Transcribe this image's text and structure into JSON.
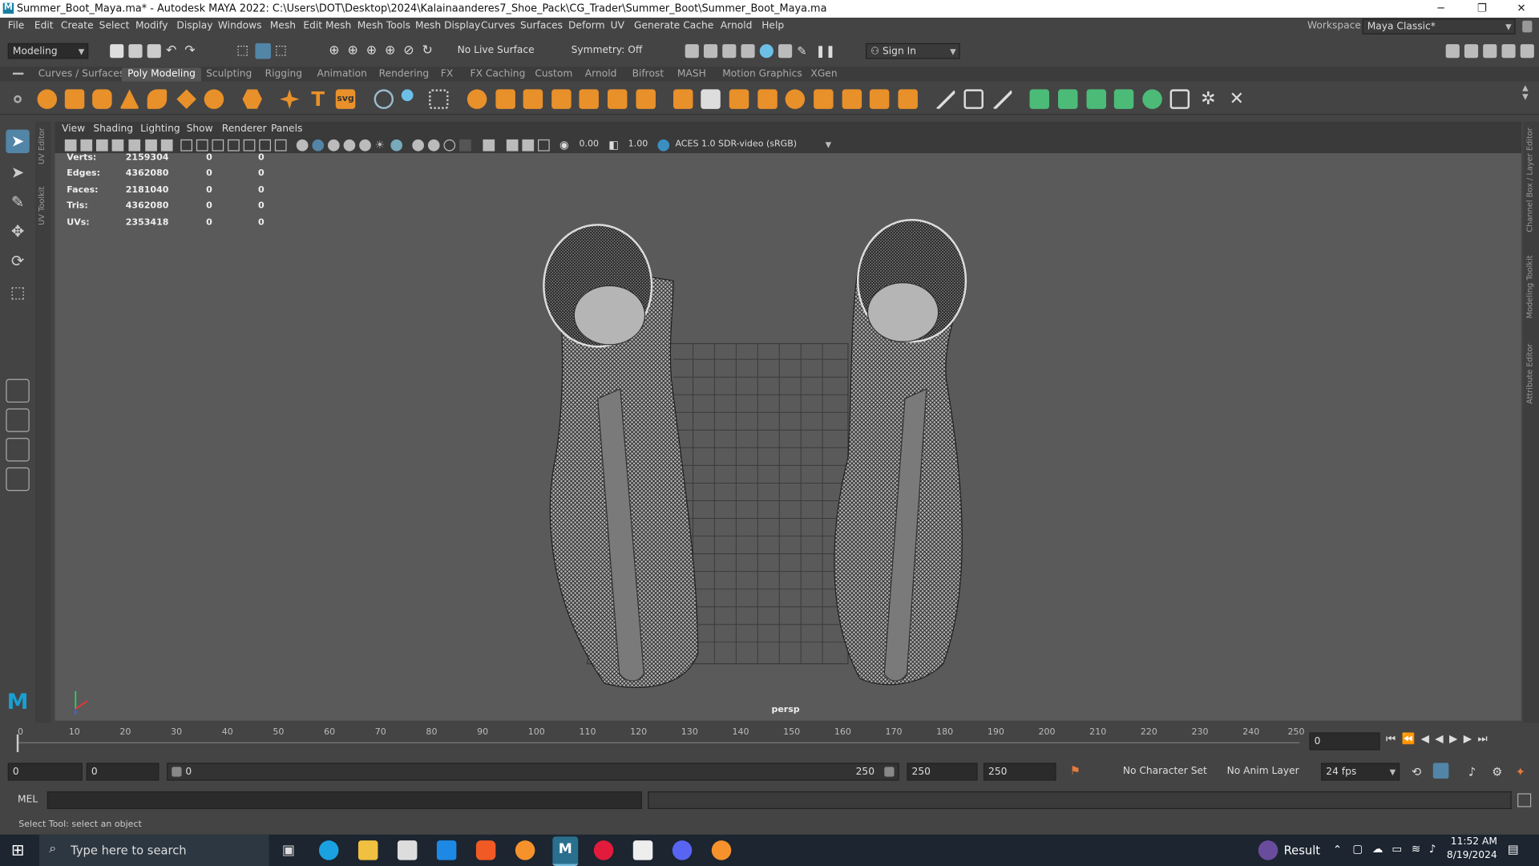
{
  "window": {
    "title": "Summer_Boot_Maya.ma* - Autodesk MAYA 2022: C:\\Users\\DOT\\Desktop\\2024\\Kalainaanderes7_Shoe_Pack\\CG_Trader\\Summer_Boot\\Summer_Boot_Maya.ma",
    "minimize": "─",
    "restore": "❐",
    "close": "✕",
    "logo": "M"
  },
  "menubar": {
    "items": [
      "File",
      "Edit",
      "Create",
      "Select",
      "Modify",
      "Display",
      "Windows",
      "Mesh",
      "Edit Mesh",
      "Mesh Tools",
      "Mesh Display",
      "Curves",
      "Surfaces",
      "Deform",
      "UV",
      "Generate",
      "Cache",
      "Arnold",
      "Help"
    ],
    "workspace_label": "Workspace :",
    "workspace_value": "Maya Classic*"
  },
  "statusline": {
    "mode": "Modeling",
    "live_surface": "No Live Surface",
    "symmetry": "Symmetry: Off",
    "sign_in": "Sign In"
  },
  "shelf": {
    "tabs": [
      "Curves / Surfaces",
      "Poly Modeling",
      "Sculpting",
      "Rigging",
      "Animation",
      "Rendering",
      "FX",
      "FX Caching",
      "Custom",
      "Arnold",
      "Bifrost",
      "MASH",
      "Motion Graphics",
      "XGen"
    ],
    "active_tab": "Poly Modeling",
    "text_icon": "T",
    "svg_icon": "svg"
  },
  "side_tabs": {
    "left": [
      "UV Editor",
      "UV Toolkit"
    ],
    "right": [
      "Channel Box / Layer Editor",
      "Modeling Toolkit",
      "Attribute Editor"
    ]
  },
  "panel": {
    "menu": [
      "View",
      "Shading",
      "Lighting",
      "Show",
      "Renderer",
      "Panels"
    ],
    "exposure": "0.00",
    "gamma": "1.00",
    "color_space": "ACES 1.0 SDR-video (sRGB)"
  },
  "hud": {
    "rows": [
      {
        "label": "Verts:",
        "total": "2159304",
        "sel": "0",
        "comp": "0"
      },
      {
        "label": "Edges:",
        "total": "4362080",
        "sel": "0",
        "comp": "0"
      },
      {
        "label": "Faces:",
        "total": "2181040",
        "sel": "0",
        "comp": "0"
      },
      {
        "label": "Tris:",
        "total": "4362080",
        "sel": "0",
        "comp": "0"
      },
      {
        "label": "UVs:",
        "total": "2353418",
        "sel": "0",
        "comp": "0"
      }
    ],
    "camera": "persp"
  },
  "timeslider": {
    "ticks": [
      "0",
      "10",
      "20",
      "30",
      "40",
      "50",
      "60",
      "70",
      "80",
      "90",
      "100",
      "110",
      "120",
      "130",
      "140",
      "150",
      "160",
      "170",
      "180",
      "190",
      "200",
      "210",
      "220",
      "230",
      "240",
      "250"
    ],
    "current_frame": "0"
  },
  "range": {
    "start": "0",
    "playback_start": "0",
    "slider_start": "0",
    "slider_end": "250",
    "playback_end": "250",
    "end": "250",
    "character_set": "No Character Set",
    "anim_layer": "No Anim Layer",
    "fps": "24 fps"
  },
  "command": {
    "label": "MEL",
    "help": "Select Tool: select an object"
  },
  "taskbar": {
    "search_placeholder": "Type here to search",
    "result": "Result",
    "time": "11:52 AM",
    "date": "8/19/2024"
  },
  "colors": {
    "ui_bg": "#444444",
    "viewport_bg": "#5a5a5a",
    "accent": "#5285a6",
    "maya_logo": "#1a7fa3"
  }
}
